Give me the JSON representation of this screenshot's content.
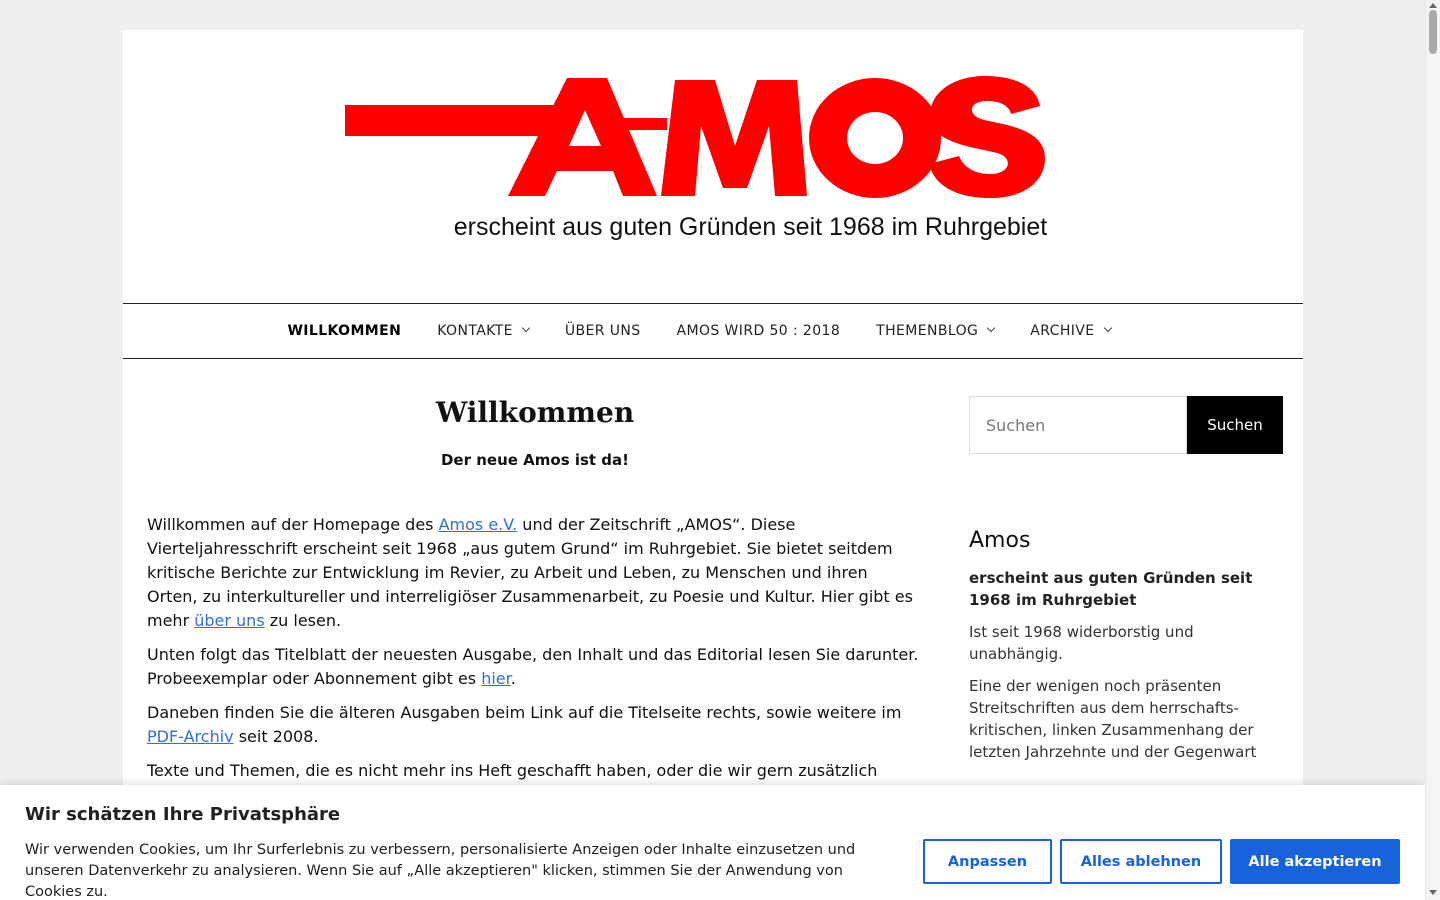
{
  "header": {
    "logo_text": "AMOS",
    "tagline": "erscheint aus guten Gründen seit 1968 im Ruhrgebiet",
    "brand_color": "#ff0000"
  },
  "nav": {
    "items": [
      {
        "label": "WILLKOMMEN",
        "active": true,
        "has_dropdown": false
      },
      {
        "label": "KONTAKTE",
        "active": false,
        "has_dropdown": true
      },
      {
        "label": "ÜBER UNS",
        "active": false,
        "has_dropdown": false
      },
      {
        "label": "AMOS WIRD 50 : 2018",
        "active": false,
        "has_dropdown": false
      },
      {
        "label": "THEMENBLOG",
        "active": false,
        "has_dropdown": true
      },
      {
        "label": "ARCHIVE",
        "active": false,
        "has_dropdown": true
      }
    ]
  },
  "main": {
    "title": "Willkommen",
    "subtitle": "Der neue Amos ist da!",
    "p1_a": "Willkommen auf der Homepage des ",
    "p1_link1": "Amos e.V.",
    "p1_b": " und der Zeitschrift „AMOS“. Diese Vierteljahresschrift erscheint seit 1968 „aus gutem Grund“ im Ruhrgebiet. Sie bietet seitdem kritische Berichte zur Entwicklung im Revier, zu Arbeit und Leben, zu Menschen und ihren Orten, zu interkultureller und interreligiöser Zusammenarbeit, zu Poesie und Kultur. Hier gibt es mehr ",
    "p1_link2": "über uns",
    "p1_c": " zu lesen.",
    "p2_a": "Unten folgt das Titelblatt der neuesten Ausgabe, den Inhalt und das Editorial lesen Sie darunter. Probeexemplar oder Abonnement gibt es ",
    "p2_link": "hier",
    "p2_b": ".",
    "p3_a": "Daneben finden Sie die älteren Ausgaben beim Link auf die Titelseite rechts, sowie weitere im ",
    "p3_link": "PDF-Archiv",
    "p3_b": " seit 2008.",
    "p4": "Texte und Themen, die es nicht mehr ins Heft geschafft haben, oder die wir gern zusätzlich"
  },
  "sidebar": {
    "search_placeholder": "Suchen",
    "search_button": "Suchen",
    "widget_title": "Amos",
    "widget_strong": "erscheint aus guten Gründen seit 1968 im Ruhrgebiet",
    "widget_text1": "Ist seit 1968 widerborstig und unabhängig.",
    "widget_text2": "Eine der wenigen noch präsenten Streitschriften aus dem herrschafts-kritischen, linken Zusammenhang der letzten Jahrzehnte und der Gegenwart"
  },
  "cookie": {
    "title": "Wir schätzen Ihre Privatsphäre",
    "text": "Wir verwenden Cookies, um Ihr Surferlebnis zu verbessern, personalisierte Anzeigen oder Inhalte einzusetzen und unseren Datenverkehr zu analysieren. Wenn Sie auf „Alle akzeptieren\" klicken, stimmen Sie der Anwendung von Cookies zu.",
    "btn_customize": "Anpassen",
    "btn_reject": "Alles ablehnen",
    "btn_accept": "Alle akzeptieren",
    "accent_color": "#1863dc"
  }
}
